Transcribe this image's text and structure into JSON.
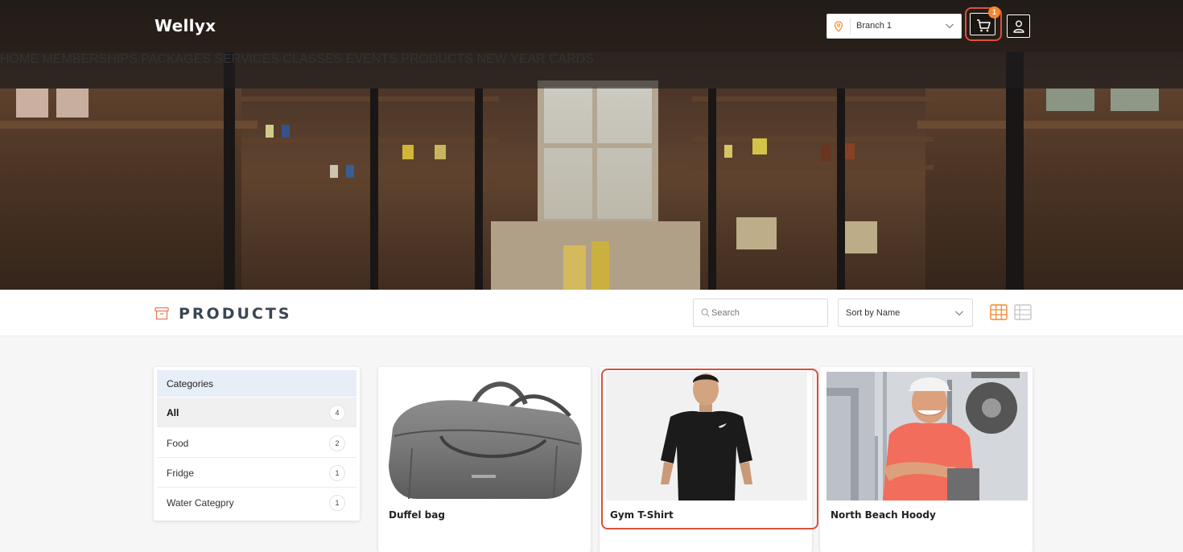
{
  "header": {
    "logo": "Wellyx",
    "branch_select": {
      "value": "Branch 1"
    },
    "cart": {
      "count": "1"
    }
  },
  "nav": {
    "items": [
      "HOME",
      "MEMBERSHIPS",
      "PACKAGES",
      "SERVICES",
      "CLASSES",
      "EVENTS",
      "PRODUCTS",
      "NEW YEAR CARDS"
    ],
    "active": "PRODUCTS"
  },
  "products_header": {
    "title": "PRODUCTS",
    "search_placeholder": "Search",
    "sort_value": "Sort by Name"
  },
  "categories": {
    "title": "Categories",
    "items": [
      {
        "name": "All",
        "count": "4"
      },
      {
        "name": "Food",
        "count": "2"
      },
      {
        "name": "Fridge",
        "count": "1"
      },
      {
        "name": "Water Categpry",
        "count": "1"
      }
    ]
  },
  "products": [
    {
      "name": "Duffel bag"
    },
    {
      "name": "Gym T-Shirt"
    },
    {
      "name": "North Beach Hoody"
    }
  ],
  "colors": {
    "accent": "#f4882c",
    "highlight": "#d9503b",
    "title_text": "#3b4554"
  }
}
